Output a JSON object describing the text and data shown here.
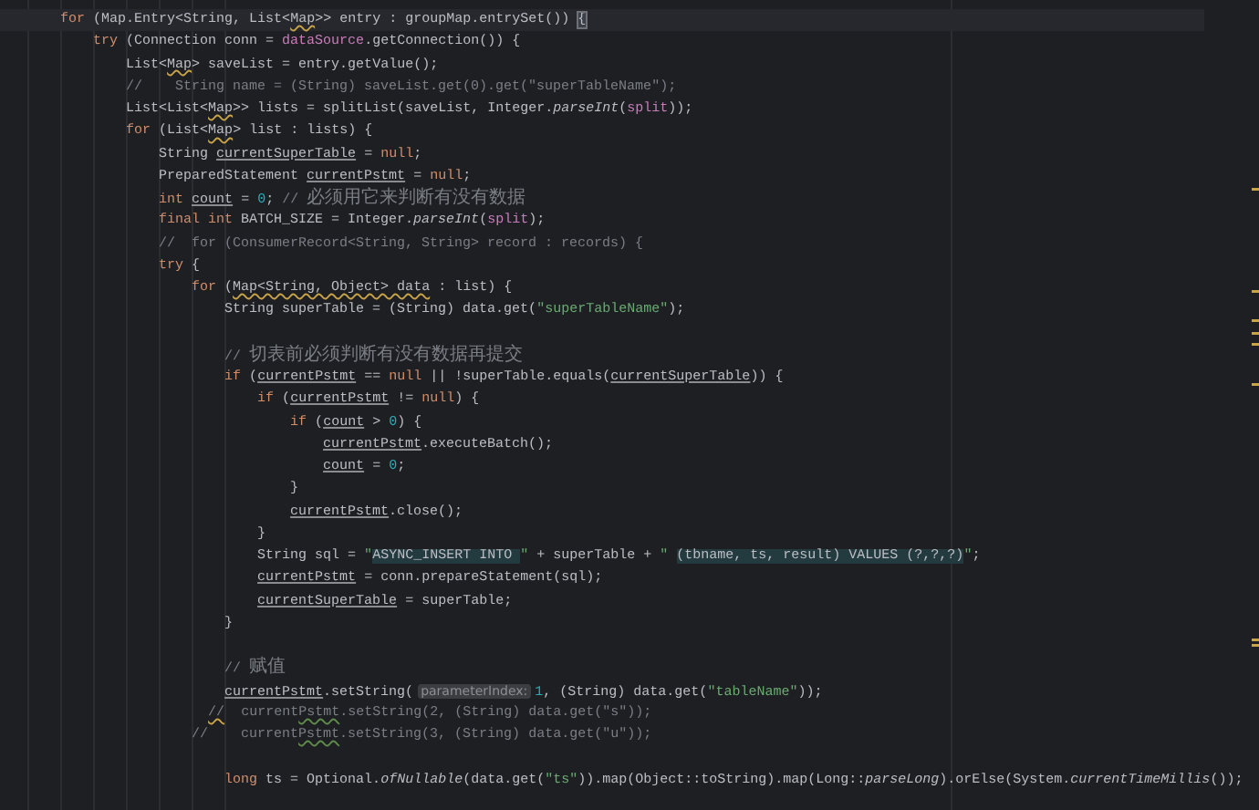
{
  "editor": {
    "lines": [
      {
        "current": true,
        "tokens": [
          {
            "kind": "keyword",
            "text": "    for "
          },
          {
            "kind": "plain",
            "text": "(Map.Entry<String, List<"
          },
          {
            "kind": "warn",
            "text": "Map"
          },
          {
            "kind": "plain",
            "text": ">> entry : groupMap.entrySet()) "
          },
          {
            "kind": "brace",
            "text": "{"
          }
        ]
      },
      {
        "current": false,
        "tokens": [
          {
            "kind": "keyword",
            "text": "        try "
          },
          {
            "kind": "plain",
            "text": "(Connection conn = "
          },
          {
            "kind": "field",
            "text": "dataSource"
          },
          {
            "kind": "plain",
            "text": ".getConnection()) {"
          }
        ]
      },
      {
        "current": false,
        "tokens": [
          {
            "kind": "plain",
            "text": "            List<"
          },
          {
            "kind": "warn",
            "text": "Map"
          },
          {
            "kind": "plain",
            "text": "> saveList = entry.getValue();"
          }
        ]
      },
      {
        "current": false,
        "tokens": [
          {
            "kind": "comment",
            "text": "            //    String name = (String) saveList.get(0).get(\"superTableName\");"
          }
        ]
      },
      {
        "current": false,
        "tokens": [
          {
            "kind": "plain",
            "text": "            List<List<"
          },
          {
            "kind": "warn",
            "text": "Map"
          },
          {
            "kind": "plain",
            "text": ">> lists = splitList(saveList, Integer."
          },
          {
            "kind": "italic",
            "text": "parseInt"
          },
          {
            "kind": "plain",
            "text": "("
          },
          {
            "kind": "field",
            "text": "split"
          },
          {
            "kind": "plain",
            "text": "));"
          }
        ]
      },
      {
        "current": false,
        "tokens": [
          {
            "kind": "keyword",
            "text": "            for "
          },
          {
            "kind": "plain",
            "text": "(List<"
          },
          {
            "kind": "warn",
            "text": "Map"
          },
          {
            "kind": "plain",
            "text": "> list : lists) {"
          }
        ]
      },
      {
        "current": false,
        "tokens": [
          {
            "kind": "plain",
            "text": "                String "
          },
          {
            "kind": "var",
            "text": "currentSuperTable"
          },
          {
            "kind": "plain",
            "text": " = "
          },
          {
            "kind": "keyword",
            "text": "null"
          },
          {
            "kind": "plain",
            "text": ";"
          }
        ]
      },
      {
        "current": false,
        "tokens": [
          {
            "kind": "plain",
            "text": "                PreparedStatement "
          },
          {
            "kind": "var",
            "text": "currentPstmt"
          },
          {
            "kind": "plain",
            "text": " = "
          },
          {
            "kind": "keyword",
            "text": "null"
          },
          {
            "kind": "plain",
            "text": ";"
          }
        ]
      },
      {
        "current": false,
        "tokens": [
          {
            "kind": "keyword",
            "text": "                int "
          },
          {
            "kind": "var",
            "text": "count"
          },
          {
            "kind": "plain",
            "text": " = "
          },
          {
            "kind": "number",
            "text": "0"
          },
          {
            "kind": "plain",
            "text": "; "
          },
          {
            "kind": "comment",
            "text": "// "
          },
          {
            "kind": "comment_cjk",
            "text": "必须用它来判断有没有数据"
          }
        ]
      },
      {
        "current": false,
        "tokens": [
          {
            "kind": "keyword",
            "text": "                final int "
          },
          {
            "kind": "plain",
            "text": "BATCH_SIZE = Integer."
          },
          {
            "kind": "italic",
            "text": "parseInt"
          },
          {
            "kind": "plain",
            "text": "("
          },
          {
            "kind": "field",
            "text": "split"
          },
          {
            "kind": "plain",
            "text": ");"
          }
        ]
      },
      {
        "current": false,
        "tokens": [
          {
            "kind": "comment",
            "text": "                //  for (ConsumerRecord<String, String> record : records) {"
          }
        ]
      },
      {
        "current": false,
        "tokens": [
          {
            "kind": "keyword",
            "text": "                try "
          },
          {
            "kind": "plain",
            "text": "{"
          }
        ]
      },
      {
        "current": false,
        "tokens": [
          {
            "kind": "keyword",
            "text": "                    for "
          },
          {
            "kind": "plain",
            "text": "("
          },
          {
            "kind": "warn",
            "text": "Map<String, Object> data"
          },
          {
            "kind": "plain",
            "text": " : list) {"
          }
        ]
      },
      {
        "current": false,
        "tokens": [
          {
            "kind": "plain",
            "text": "                        String superTable = (String) data.get("
          },
          {
            "kind": "string",
            "text": "\"superTableName\""
          },
          {
            "kind": "plain",
            "text": ");"
          }
        ]
      },
      {
        "current": false
      },
      {
        "current": false,
        "tokens": [
          {
            "kind": "comment",
            "text": "                        // "
          },
          {
            "kind": "comment_cjk",
            "text": "切表前必须判断有没有数据再提交"
          }
        ]
      },
      {
        "current": false,
        "tokens": [
          {
            "kind": "keyword",
            "text": "                        if "
          },
          {
            "kind": "plain",
            "text": "("
          },
          {
            "kind": "var",
            "text": "currentPstmt"
          },
          {
            "kind": "plain",
            "text": " == "
          },
          {
            "kind": "keyword",
            "text": "null"
          },
          {
            "kind": "plain",
            "text": " || !superTable.equals("
          },
          {
            "kind": "var",
            "text": "currentSuperTable"
          },
          {
            "kind": "plain",
            "text": ")) {"
          }
        ]
      },
      {
        "current": false,
        "tokens": [
          {
            "kind": "keyword",
            "text": "                            if "
          },
          {
            "kind": "plain",
            "text": "("
          },
          {
            "kind": "var",
            "text": "currentPstmt"
          },
          {
            "kind": "plain",
            "text": " != "
          },
          {
            "kind": "keyword",
            "text": "null"
          },
          {
            "kind": "plain",
            "text": ") {"
          }
        ]
      },
      {
        "current": false,
        "tokens": [
          {
            "kind": "keyword",
            "text": "                                if "
          },
          {
            "kind": "plain",
            "text": "("
          },
          {
            "kind": "var",
            "text": "count"
          },
          {
            "kind": "plain",
            "text": " > "
          },
          {
            "kind": "number",
            "text": "0"
          },
          {
            "kind": "plain",
            "text": ") {"
          }
        ]
      },
      {
        "current": false,
        "tokens": [
          {
            "kind": "var",
            "text": "                                    currentPstmt"
          },
          {
            "kind": "plain",
            "text": ".executeBatch();"
          }
        ]
      },
      {
        "current": false,
        "tokens": [
          {
            "kind": "var",
            "text": "                                    count"
          },
          {
            "kind": "plain",
            "text": " = "
          },
          {
            "kind": "number",
            "text": "0"
          },
          {
            "kind": "plain",
            "text": ";"
          }
        ]
      },
      {
        "current": false,
        "tokens": [
          {
            "kind": "plain",
            "text": "                                }"
          }
        ]
      },
      {
        "current": false,
        "tokens": [
          {
            "kind": "var",
            "text": "                                currentPstmt"
          },
          {
            "kind": "plain",
            "text": ".close();"
          }
        ]
      },
      {
        "current": false,
        "tokens": [
          {
            "kind": "plain",
            "text": "                            }"
          }
        ]
      },
      {
        "current": false,
        "tokens": [
          {
            "kind": "plain",
            "text": "                            String sql = "
          },
          {
            "kind": "string",
            "text": "\""
          },
          {
            "kind": "injected",
            "text": "ASYNC_INSERT INTO "
          },
          {
            "kind": "string",
            "text": "\""
          },
          {
            "kind": "plain",
            "text": " + superTable + "
          },
          {
            "kind": "string",
            "text": "\""
          },
          {
            "kind": "injected",
            "text": " (tbname, ts, result) VALUES (?,?,?)"
          },
          {
            "kind": "string",
            "text": "\""
          },
          {
            "kind": "plain",
            "text": ";"
          }
        ]
      },
      {
        "current": false,
        "tokens": [
          {
            "kind": "var",
            "text": "                            currentPstmt"
          },
          {
            "kind": "plain",
            "text": " = conn.prepareStatement(sql);"
          }
        ]
      },
      {
        "current": false,
        "tokens": [
          {
            "kind": "var",
            "text": "                            currentSuperTable"
          },
          {
            "kind": "plain",
            "text": " = superTable;"
          }
        ]
      },
      {
        "current": false,
        "tokens": [
          {
            "kind": "plain",
            "text": "                        }"
          }
        ]
      },
      {
        "current": false
      },
      {
        "current": false,
        "tokens": [
          {
            "kind": "comment",
            "text": "                        // "
          },
          {
            "kind": "comment_cjk",
            "text": "赋值"
          }
        ]
      },
      {
        "current": false,
        "tokens": [
          {
            "kind": "var",
            "text": "                        currentPstmt"
          },
          {
            "kind": "plain",
            "text": ".setString("
          },
          {
            "kind": "hint",
            "text": "parameterIndex:"
          },
          {
            "kind": "number",
            "text": "1"
          },
          {
            "kind": "plain",
            "text": ", (String) data.get("
          },
          {
            "kind": "string",
            "text": "\"tableName\""
          },
          {
            "kind": "plain",
            "text": "));"
          }
        ]
      },
      {
        "current": false,
        "tokens": [
          {
            "kind": "comment_warn",
            "text": "                      //"
          },
          {
            "kind": "comment",
            "text": "  current"
          },
          {
            "kind": "comment_typo",
            "text": "Pstmt"
          },
          {
            "kind": "comment",
            "text": ".setString(2, (String) data.get(\"s\"));"
          }
        ]
      },
      {
        "current": false,
        "tokens": [
          {
            "kind": "comment",
            "text": "                    //    current"
          },
          {
            "kind": "comment_typo",
            "text": "Pstmt"
          },
          {
            "kind": "comment",
            "text": ".setString(3, (String) data.get(\"u\"));"
          }
        ]
      },
      {
        "current": false
      },
      {
        "current": false,
        "tokens": [
          {
            "kind": "keyword",
            "text": "                        long "
          },
          {
            "kind": "plain",
            "text": "ts = Optional."
          },
          {
            "kind": "italic",
            "text": "ofNullable"
          },
          {
            "kind": "plain",
            "text": "(data.get("
          },
          {
            "kind": "string",
            "text": "\"ts\""
          },
          {
            "kind": "plain",
            "text": ")).map(Object::toString).map(Long::"
          },
          {
            "kind": "italic",
            "text": "parseLong"
          },
          {
            "kind": "plain",
            "text": ").orElse(System."
          },
          {
            "kind": "italic",
            "text": "currentTimeMillis"
          },
          {
            "kind": "plain",
            "text": "());"
          }
        ]
      }
    ]
  }
}
